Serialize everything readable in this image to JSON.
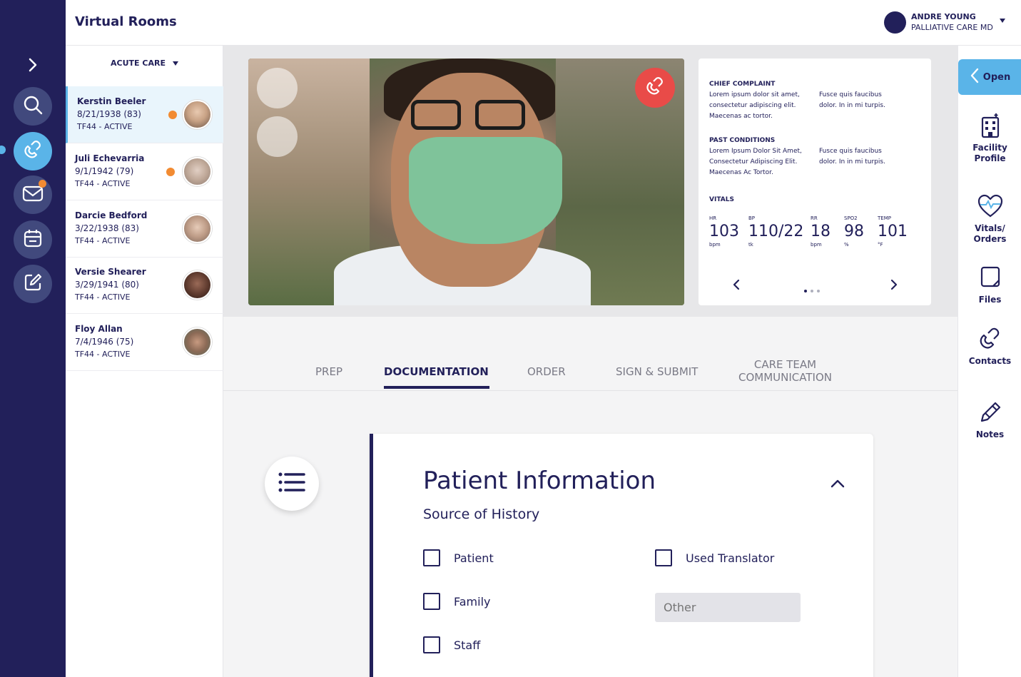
{
  "app": {
    "title": "Virtual Rooms"
  },
  "user": {
    "name": "ANDRE YOUNG",
    "role": "PALLIATIVE CARE MD"
  },
  "colors": {
    "navy": "#22205a",
    "accent_blue": "#5ab4e8",
    "alert_orange": "#f28b32",
    "end_call_red": "#e94b48",
    "mask_green": "#7fc39a"
  },
  "nav": {
    "items": [
      {
        "name": "search",
        "icon": "search-icon"
      },
      {
        "name": "call",
        "icon": "phone-icon",
        "active": true
      },
      {
        "name": "messages",
        "icon": "mail-icon",
        "badge": true
      },
      {
        "name": "calendar",
        "icon": "calendar-icon"
      },
      {
        "name": "tasks",
        "icon": "edit-icon"
      }
    ]
  },
  "patient_list": {
    "filter": "ACUTE CARE",
    "patients": [
      {
        "name": "Kerstin Beeler",
        "dob": "8/21/1938 (83)",
        "status": "TF44 - ACTIVE",
        "alert": true,
        "selected": true
      },
      {
        "name": "Juli Echevarria",
        "dob": "9/1/1942 (79)",
        "status": "TF44 - ACTIVE",
        "alert": true
      },
      {
        "name": "Darcie Bedford",
        "dob": "3/22/1938 (83)",
        "status": "TF44 - ACTIVE",
        "alert": false
      },
      {
        "name": "Versie Shearer",
        "dob": "3/29/1941 (80)",
        "status": "TF44 - ACTIVE",
        "alert": false
      },
      {
        "name": "Floy Allan",
        "dob": "7/4/1946 (75)",
        "status": "TF44 - ACTIVE",
        "alert": false
      }
    ]
  },
  "summary": {
    "chief_complaint": {
      "heading": "CHIEF COMPLAINT",
      "col1": "Lorem ipsum dolor sit amet, consectetur adipiscing elit. Maecenas ac tortor.",
      "col2": "Fusce quis faucibus dolor. In in mi turpis."
    },
    "past_conditions": {
      "heading": "PAST CONDITIONS",
      "col1": "Lorem Ipsum Dolor Sit Amet, Consectetur Adipiscing Elit. Maecenas Ac Tortor.",
      "col2": "Fusce quis faucibus dolor. In in mi turpis."
    },
    "vitals_heading": "VITALS",
    "vitals": [
      {
        "label": "HR",
        "value": "103",
        "unit": "bpm"
      },
      {
        "label": "BP",
        "value": "110/22",
        "unit": "tk"
      },
      {
        "label": "RR",
        "value": "18",
        "unit": "bpm"
      },
      {
        "label": "SPO2",
        "value": "98",
        "unit": "%"
      },
      {
        "label": "TEMP",
        "value": "101",
        "unit": "°F"
      }
    ],
    "page_count": 3,
    "current_page": 1
  },
  "tabs": {
    "prep": "PREP",
    "documentation": "DOCUMENTATION",
    "order": "ORDER",
    "sign": "SIGN & SUBMIT",
    "care_line1": "CARE TEAM",
    "care_line2": "COMMUNICATION",
    "active": "documentation"
  },
  "patient_info": {
    "title": "Patient Information",
    "subtitle": "Source of History",
    "options": {
      "patient": "Patient",
      "family": "Family",
      "staff": "Staff",
      "translator": "Used Translator"
    },
    "other_placeholder": "Other"
  },
  "sidebar_right": {
    "open_label": "Open",
    "facility_line1": "Facility",
    "facility_line2": "Profile",
    "vitals_line1": "Vitals/",
    "vitals_line2": "Orders",
    "files": "Files",
    "contacts": "Contacts",
    "notes": "Notes"
  }
}
